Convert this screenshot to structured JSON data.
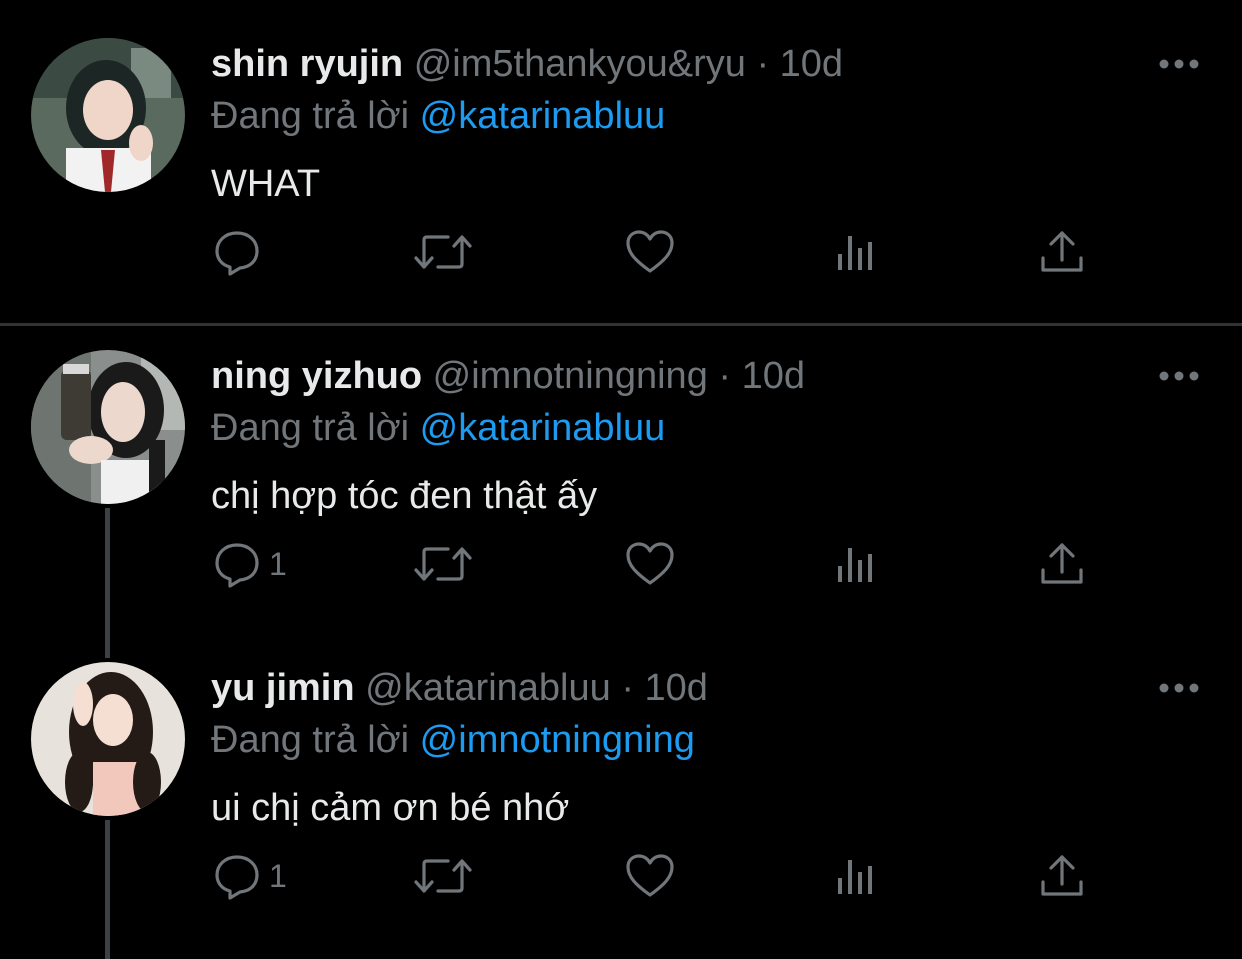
{
  "tweets": [
    {
      "name": "shin ryujin",
      "handle": "@im5thankyou&ryu",
      "dot": "·",
      "time": "10d",
      "reply_prefix": "Đang trả lời",
      "reply_mention": "@katarinabluu",
      "text": "WHAT",
      "reply_count": "",
      "icons": [
        "reply-icon",
        "retweet-icon",
        "like-icon",
        "views-icon",
        "share-icon",
        "more-icon"
      ]
    },
    {
      "name": "ning yizhuo",
      "handle": "@imnotningning",
      "dot": "·",
      "time": "10d",
      "reply_prefix": "Đang trả lời",
      "reply_mention": "@katarinabluu",
      "text": "chị hợp tóc đen thật ấy",
      "reply_count": "1",
      "icons": [
        "reply-icon",
        "retweet-icon",
        "like-icon",
        "views-icon",
        "share-icon",
        "more-icon"
      ]
    },
    {
      "name": "yu jimin",
      "handle": "@katarinabluu",
      "dot": "·",
      "time": "10d",
      "reply_prefix": "Đang trả lời",
      "reply_mention": "@imnotningning",
      "text": "ui chị cảm ơn bé nhớ",
      "reply_count": "1",
      "icons": [
        "reply-icon",
        "retweet-icon",
        "like-icon",
        "views-icon",
        "share-icon",
        "more-icon"
      ]
    }
  ],
  "colors": {
    "background": "#000000",
    "primary_text": "#e7e9ea",
    "secondary_text": "#71767b",
    "link": "#1d9bf0",
    "divider": "#2f3336"
  }
}
